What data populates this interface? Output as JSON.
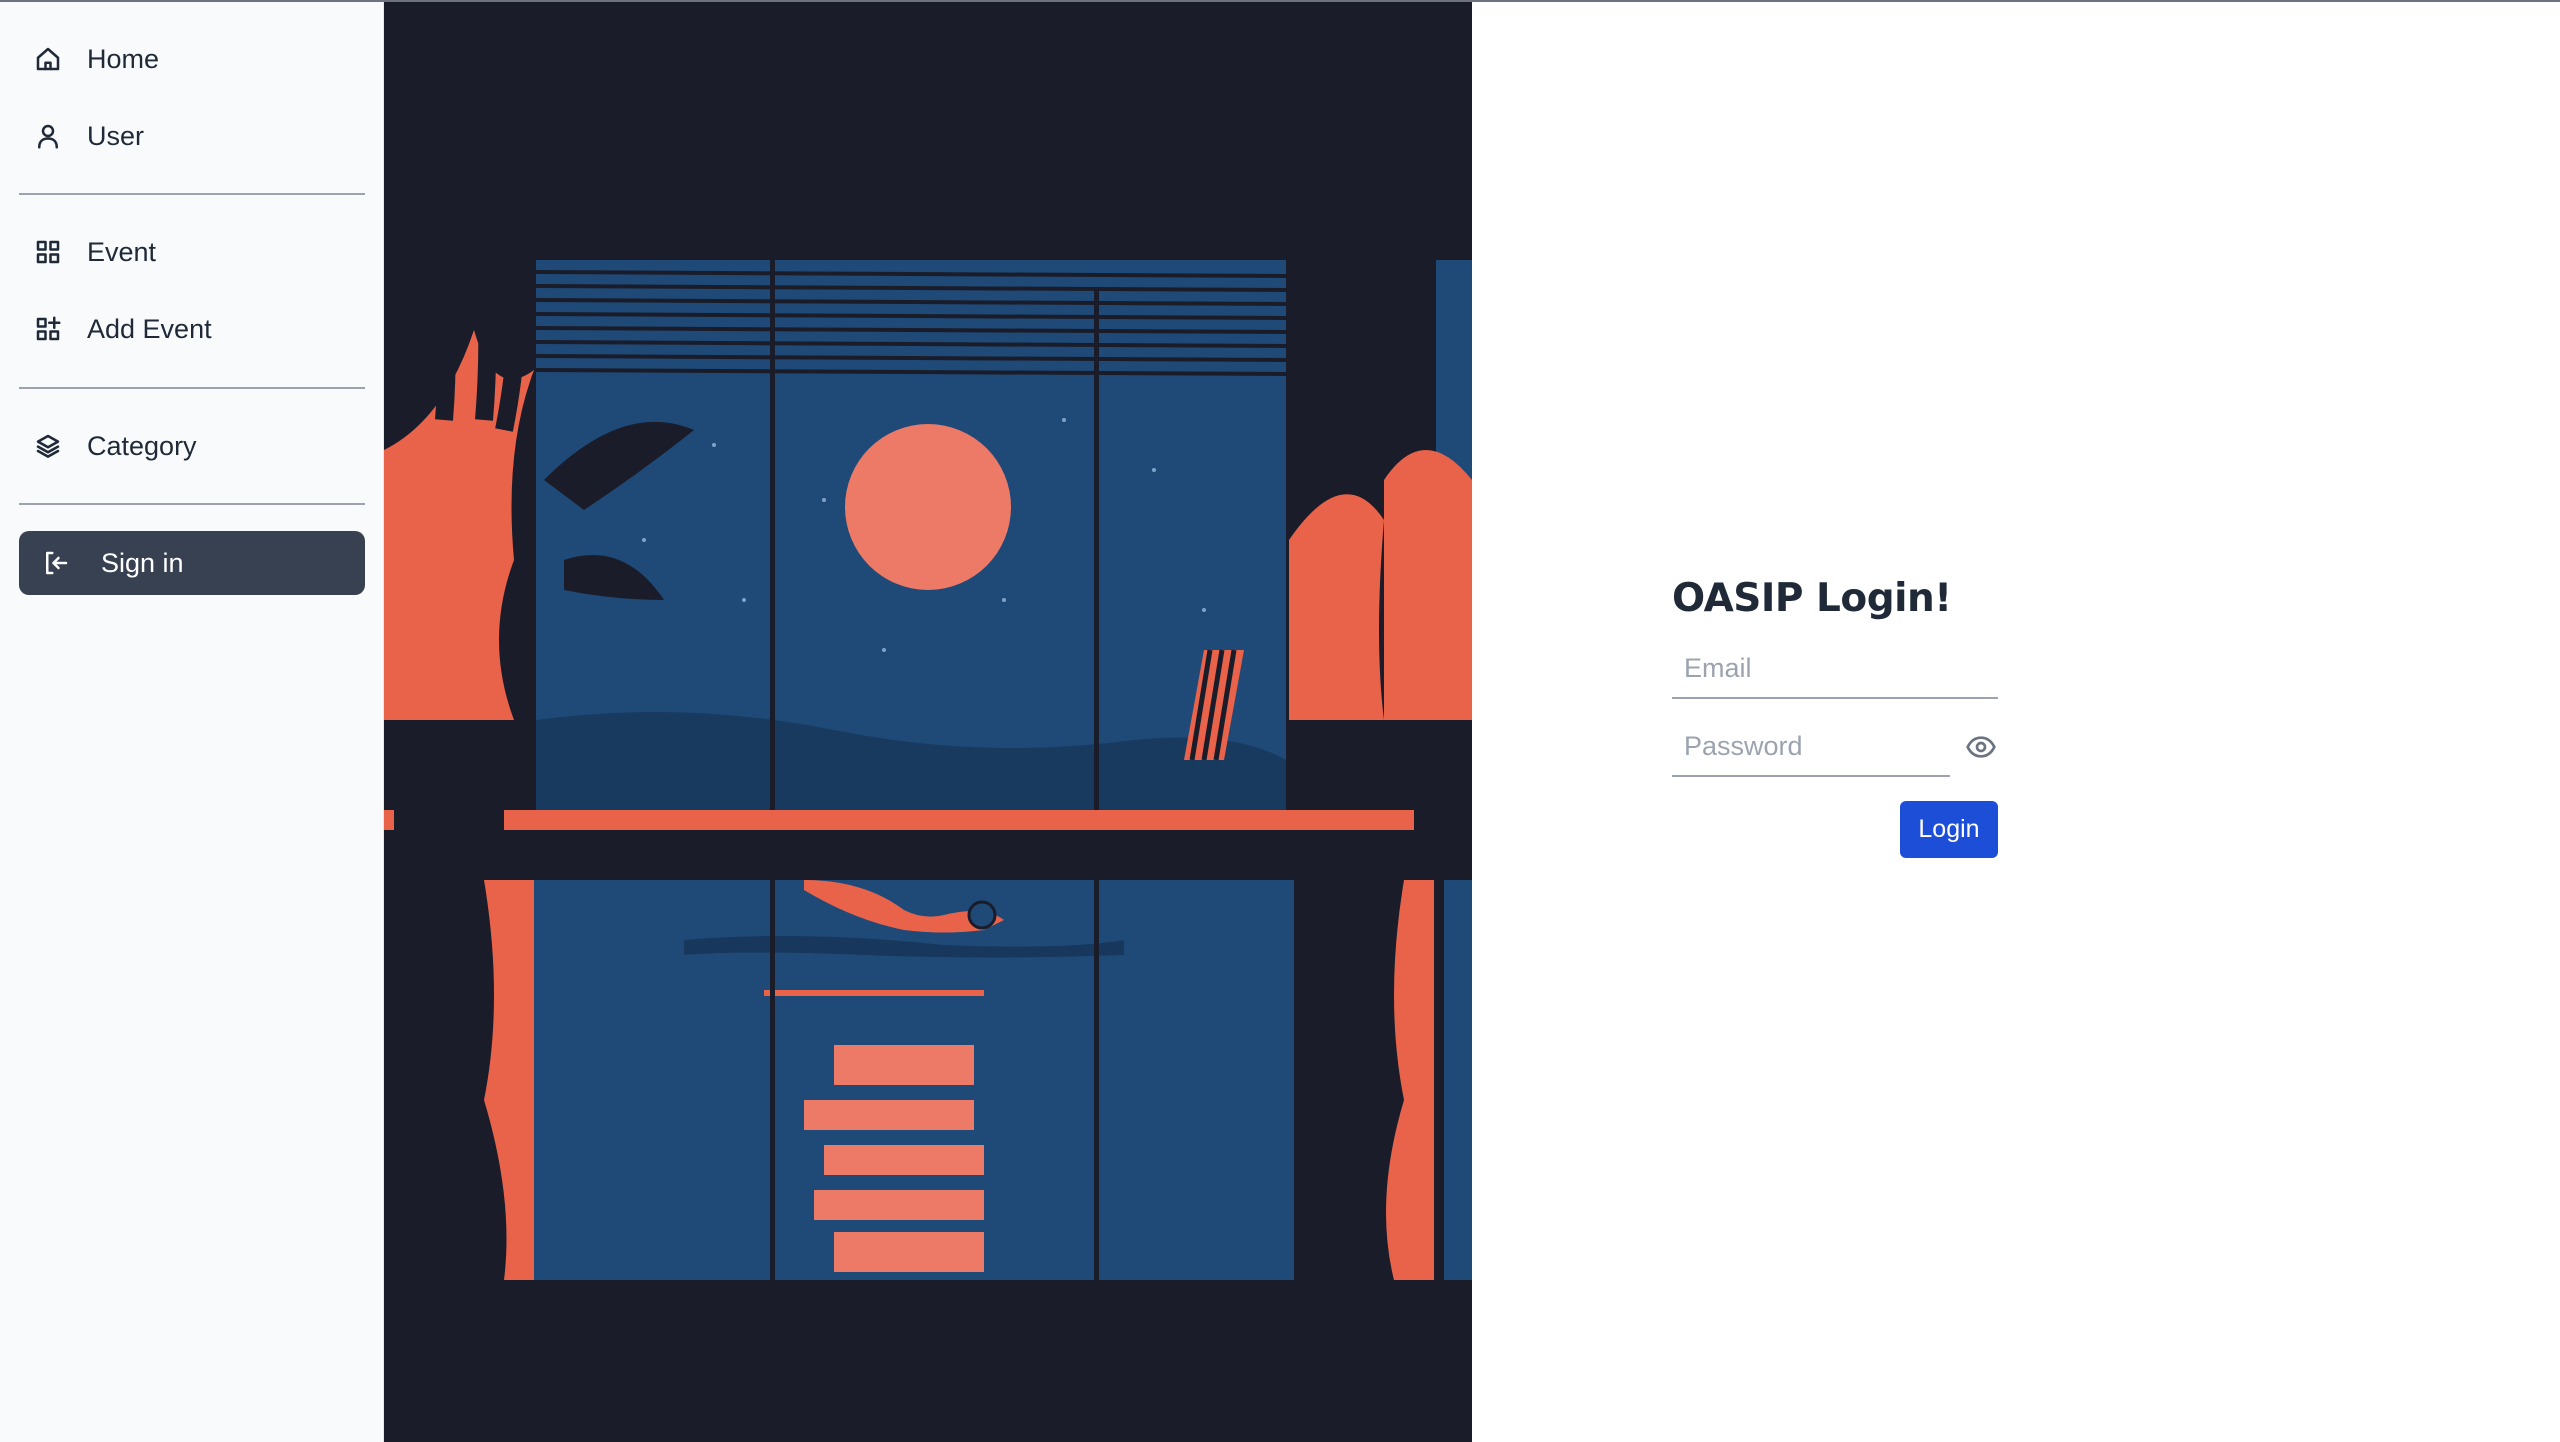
{
  "sidebar": {
    "items": [
      {
        "label": "Home",
        "icon": "home-icon"
      },
      {
        "label": "User",
        "icon": "user-icon"
      },
      {
        "label": "Event",
        "icon": "grid-icon"
      },
      {
        "label": "Add Event",
        "icon": "grid-add-icon"
      },
      {
        "label": "Category",
        "icon": "layers-icon"
      }
    ],
    "signin": {
      "label": "Sign in",
      "icon": "sign-in-icon"
    }
  },
  "illustration": {
    "description_icon": "night-pool-illustration",
    "colors": {
      "night": "#1a1d29",
      "sky": "#1f4a78",
      "moon": "#ec7a66",
      "accent": "#e8634a"
    }
  },
  "login": {
    "title": "OASIP Login!",
    "email_placeholder": "Email",
    "password_placeholder": "Password",
    "submit_label": "Login",
    "accent": "#1d4ed8"
  }
}
